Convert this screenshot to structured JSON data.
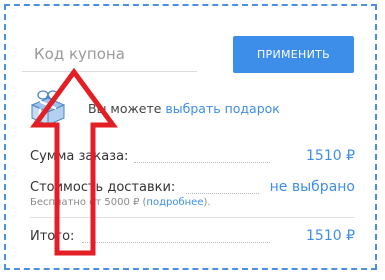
{
  "coupon": {
    "placeholder": "Код купона",
    "apply_label": "ПРИМЕНИТЬ"
  },
  "gift": {
    "icon": "gift-box-icon",
    "text_prefix": "Вы можете ",
    "link_label": "выбрать подарок"
  },
  "summary": {
    "order_sum_label": "Сумма заказа:",
    "order_sum_value": "1510 ₽",
    "delivery_label": "Стоимость доставки:",
    "delivery_value": "не выбрано",
    "free_note_prefix": "Бесплатно от 5000 ₽ (",
    "free_note_link": "подробнее",
    "free_note_suffix": ").",
    "total_label": "Итого:",
    "total_value": "1510 ₽"
  },
  "colors": {
    "accent": "#3d8ee8",
    "annotation_arrow": "#e31e24",
    "frame_border": "#4a8fe0"
  }
}
